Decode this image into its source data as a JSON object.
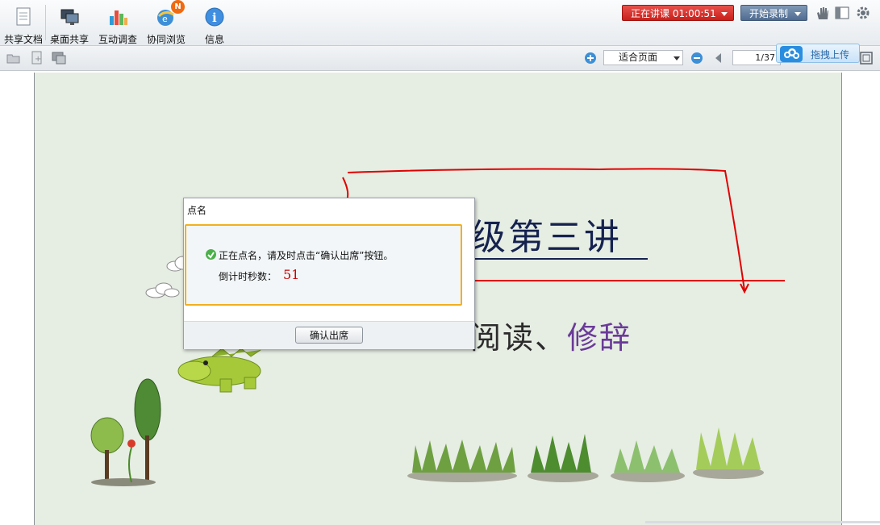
{
  "toolbar": {
    "items": [
      {
        "label": "共享文档"
      },
      {
        "label": "桌面共享"
      },
      {
        "label": "互动调查"
      },
      {
        "label": "协同浏览",
        "badge": "N"
      },
      {
        "label": "信息"
      }
    ],
    "live_status": "正在讲课 01:00:51",
    "record_label": "开始录制"
  },
  "subbar": {
    "zoom_value": "适合页面",
    "page_indicator": "1/37",
    "upload_label": "拖拽上传"
  },
  "slide": {
    "title_visible": "级第三讲",
    "subtitle_part1": "阅读、",
    "subtitle_part2": "修辞"
  },
  "dialog": {
    "title": "点名",
    "message": "正在点名，请及时点击“确认出席”按钮。",
    "countdown_label": "倒计时秒数：",
    "countdown_value": "51",
    "confirm_label": "确认出席"
  },
  "colors": {
    "live": "#c91f1a",
    "record": "#4f6b90",
    "dialog_border": "#f2b01e",
    "countdown": "#cc0000",
    "annotation": "#e00000"
  }
}
